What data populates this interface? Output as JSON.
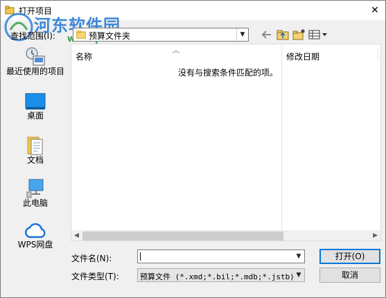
{
  "window": {
    "title": "打开项目"
  },
  "watermark": {
    "title": "河东软件园",
    "url": "www.pc0359.cn"
  },
  "lookin": {
    "label": "查找范围(I):",
    "value": "预算文件夹"
  },
  "places": [
    {
      "id": "recent",
      "label": "最近使用的项目"
    },
    {
      "id": "desktop",
      "label": "桌面"
    },
    {
      "id": "documents",
      "label": "文档"
    },
    {
      "id": "thispc",
      "label": "此电脑"
    },
    {
      "id": "wps",
      "label": "WPS网盘"
    }
  ],
  "filelist": {
    "columns": [
      "名称",
      "修改日期"
    ],
    "empty_message": "没有与搜索条件匹配的项。"
  },
  "filename": {
    "label": "文件名(N):",
    "value": ""
  },
  "filetype": {
    "label": "文件类型(T):",
    "value": "预算文件 (*.xmd;*.bil;*.mdb;*.jstb)"
  },
  "buttons": {
    "open": "打开(O)",
    "cancel": "取消"
  },
  "colors": {
    "accent": "#0078d7",
    "watermark_blue": "#2c7fd8",
    "watermark_green": "#33a14b"
  }
}
